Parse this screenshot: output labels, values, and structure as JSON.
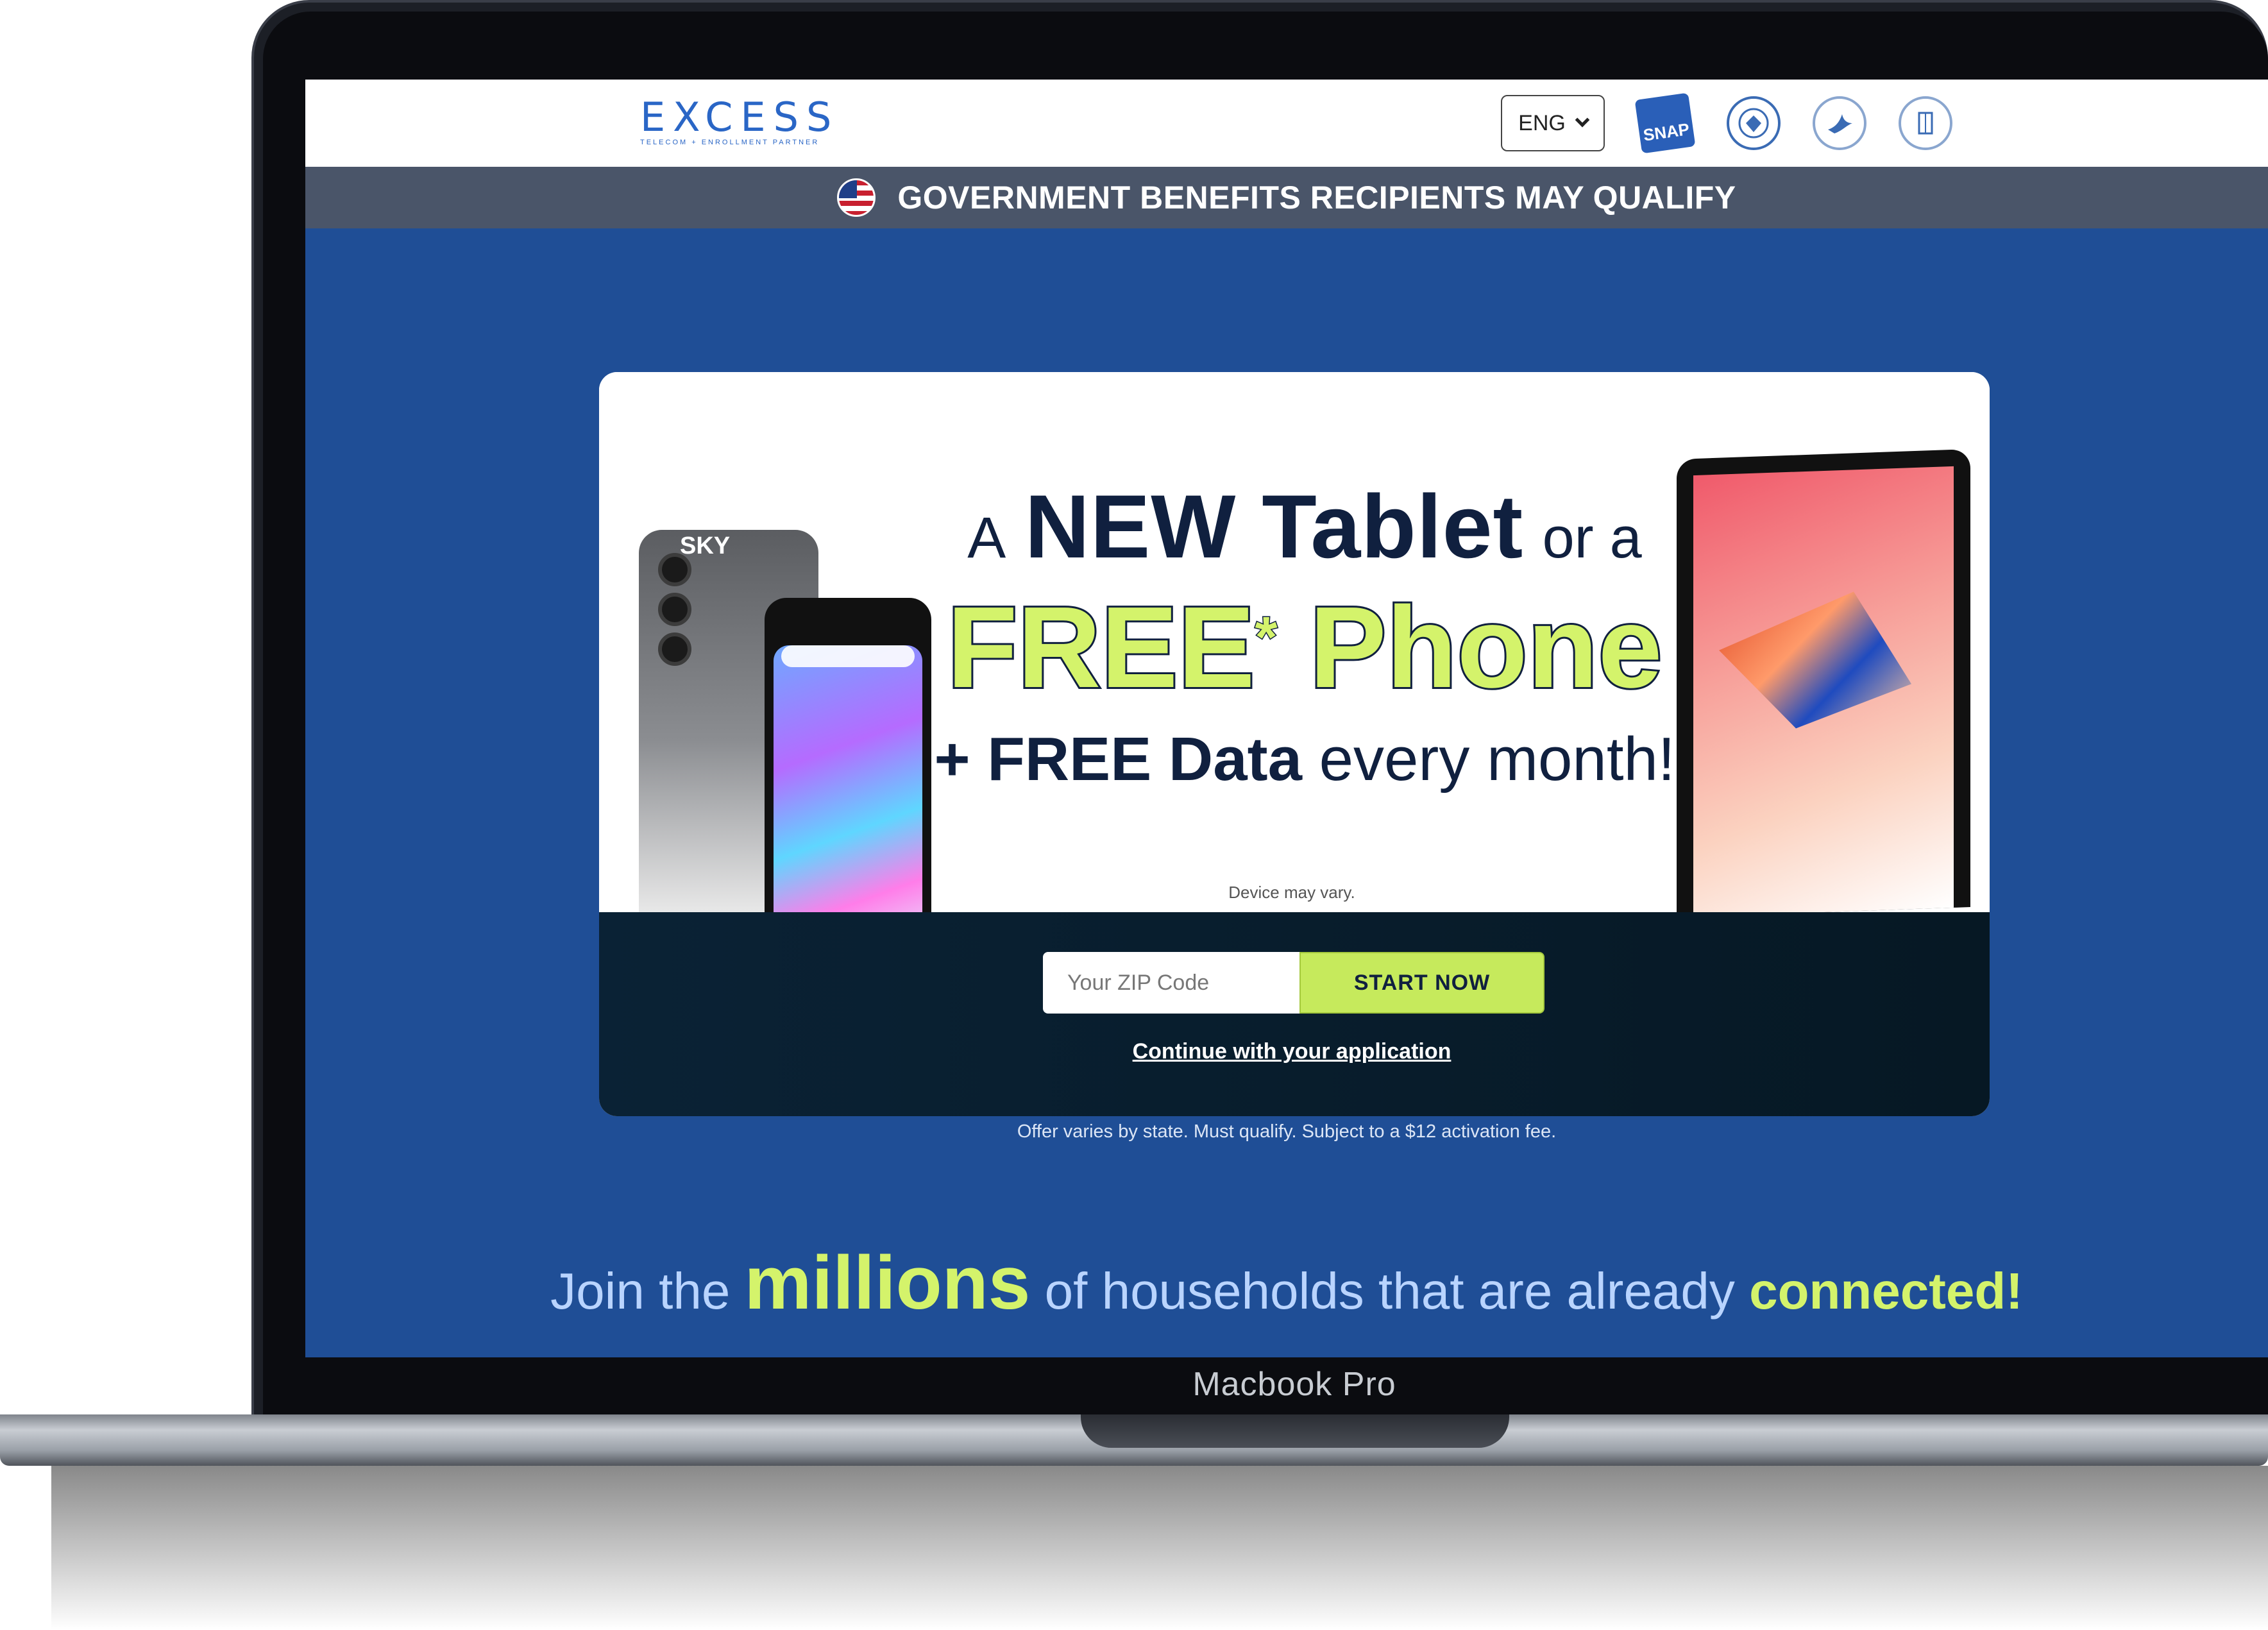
{
  "device": {
    "model_label": "Macbook Pro"
  },
  "header": {
    "logo": {
      "word": "EXCESS",
      "tagline": "Telecom + Enrollment Partner"
    },
    "language": {
      "selected": "ENG"
    },
    "agency_logos": [
      "snap-logo",
      "veterans-affairs-seal",
      "hhs-seal",
      "hud-seal"
    ],
    "snap_label": "SNAP"
  },
  "banner": {
    "text": "GOVERNMENT BENEFITS RECIPIENTS MAY QUALIFY"
  },
  "hero": {
    "line1_a": "A",
    "line1_b": "NEW Tablet",
    "line1_c": "or a",
    "line2_a": "FREE",
    "line2_star": "*",
    "line2_b": "Phone",
    "line3_a": "+ FREE Data",
    "line3_b": "every month!",
    "device_note": "Device may vary.",
    "phone_brand": "SKY"
  },
  "form": {
    "zip_placeholder": "Your ZIP Code",
    "zip_value": "",
    "start_label": "START NOW",
    "continue_label": "Continue with your application"
  },
  "offer_note": "Offer varies by state. Must qualify. Subject to a $12 activation fee.",
  "join": {
    "part1": "Join the",
    "part2": "millions",
    "part3": "of households that are already",
    "part4": "connected!"
  },
  "colors": {
    "page_blue": "#1f4e96",
    "banner_gray": "#4a5569",
    "accent_lime": "#d4f36b",
    "button_lime": "#c6ea5c",
    "navy_text": "#10203f",
    "logo_blue": "#2a66c6"
  }
}
